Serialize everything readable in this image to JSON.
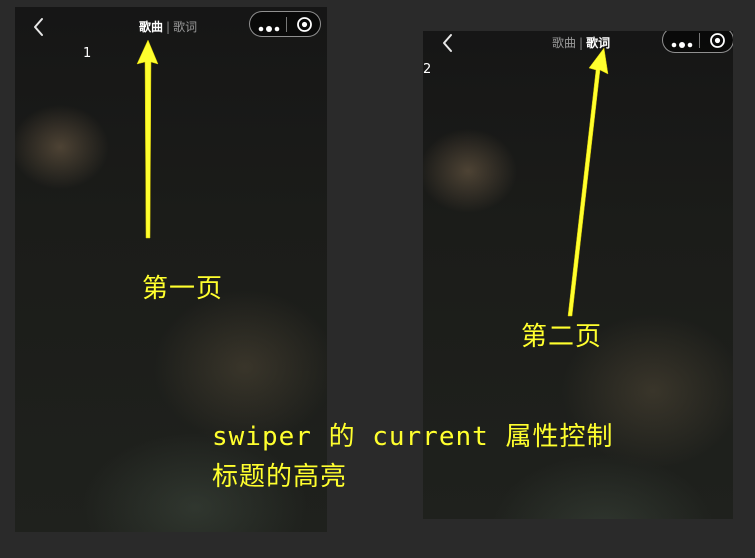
{
  "screens": [
    {
      "tabs": [
        {
          "label": "歌曲",
          "active": true
        },
        {
          "label": "歌词",
          "active": false
        }
      ],
      "separator": "|",
      "page_number": "1",
      "annotation": "第一页"
    },
    {
      "tabs": [
        {
          "label": "歌曲",
          "active": false
        },
        {
          "label": "歌词",
          "active": true
        }
      ],
      "separator": "|",
      "page_number": "2",
      "annotation": "第二页"
    }
  ],
  "note_lines": [
    "swiper 的 current 属性控制",
    "标题的高亮"
  ],
  "icons": [
    "back-chevron-icon",
    "more-dots-icon",
    "target-circle-icon"
  ],
  "colors": {
    "annotation": "#ffff2e",
    "page_background": "#2a2a2a",
    "active_tab": "#ffffff",
    "inactive_tab": "#9a9a9a"
  }
}
